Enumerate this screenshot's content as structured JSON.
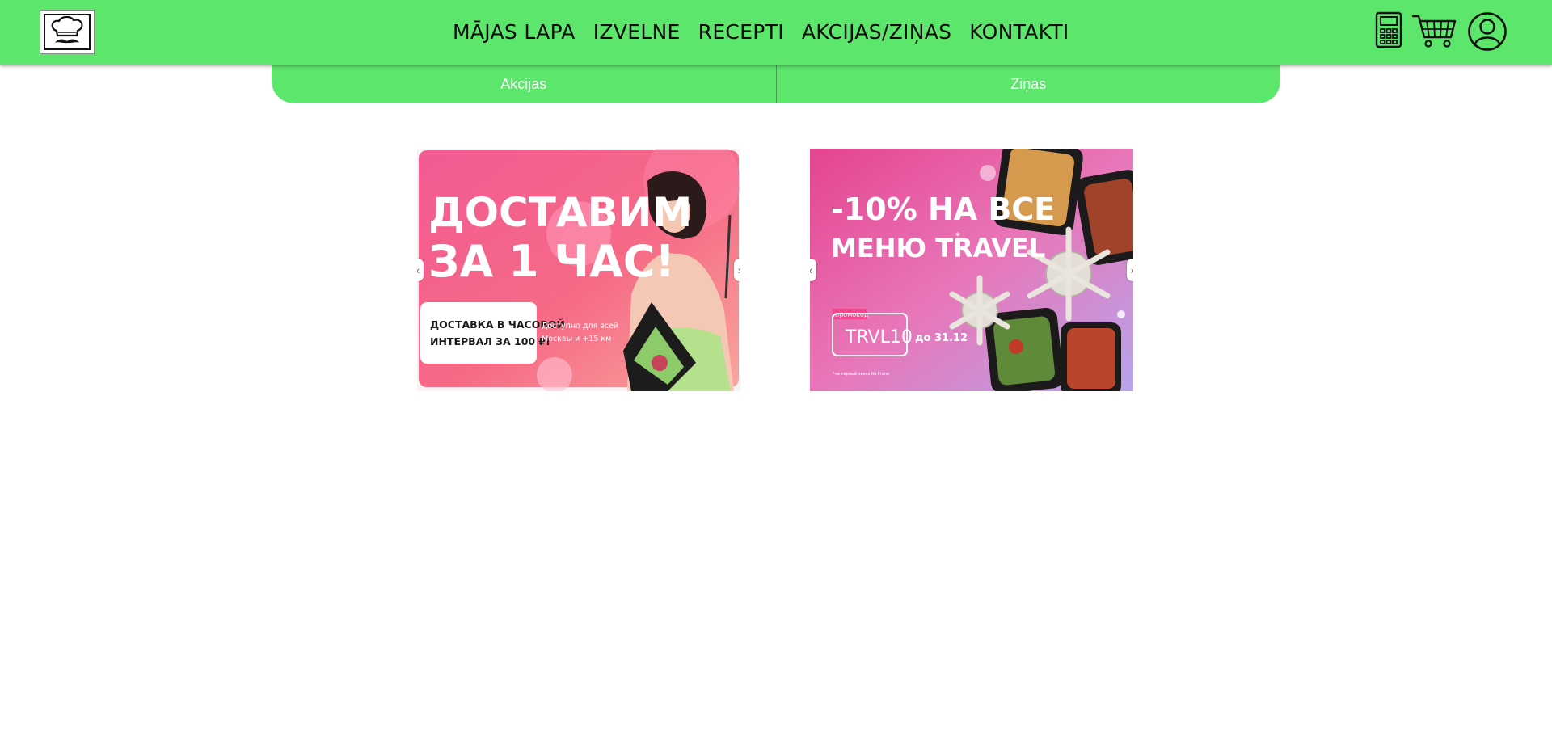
{
  "header": {
    "nav": [
      {
        "label": "MĀJAS LAPA"
      },
      {
        "label": "IZVELNE"
      },
      {
        "label": "RECEPTI"
      },
      {
        "label": "AKCIJAS/ZIŅAS"
      },
      {
        "label": "KONTAKTI"
      }
    ],
    "icons": [
      "calculator-icon",
      "cart-icon",
      "user-icon"
    ],
    "accent_color": "#5ce66b"
  },
  "subnav": {
    "items": [
      {
        "label": "Akcijas"
      },
      {
        "label": "Ziņas"
      }
    ]
  },
  "banners": [
    {
      "headline_1": "ДОСТАВИМ",
      "headline_2": "ЗА 1 ЧАС!",
      "box_line_1": "ДОСТАВКА В ЧАСОВОЙ",
      "box_line_2": "ИНТЕРВАЛ ЗА 100 ₽!",
      "note_1": "Доступно для всей",
      "note_2": "Москвы и +15 км",
      "prev": "‹",
      "next": "›"
    },
    {
      "headline_1": "-10% НА ВСЕ",
      "headline_2": "МЕНЮ TRAVEL",
      "asterisk": "*",
      "promo_label": "промокод",
      "promo_code": "TRVL10",
      "promo_until": "до 31.12",
      "fine_print": "*на первый заказ Re:Prime",
      "prev": "‹",
      "next": "›"
    }
  ]
}
